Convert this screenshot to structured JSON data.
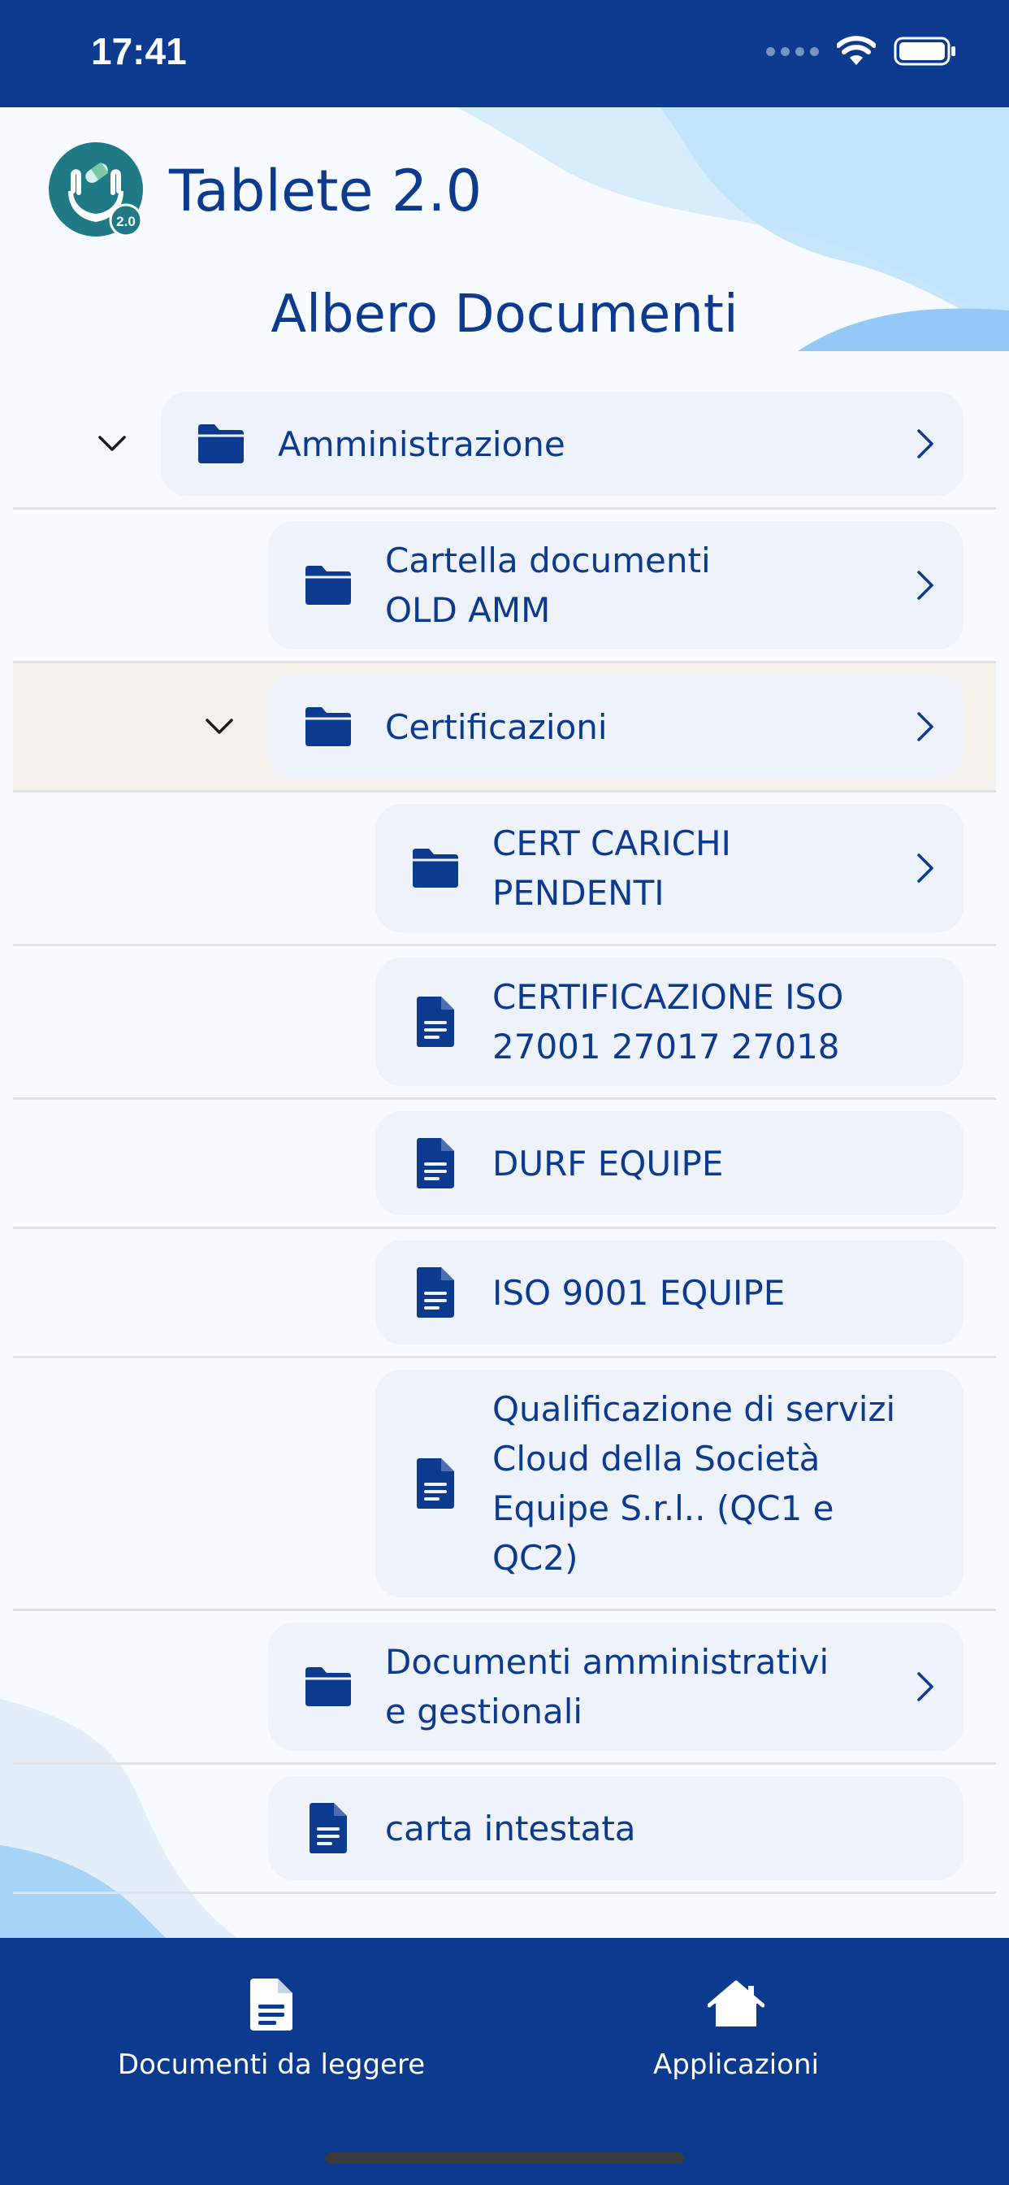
{
  "status": {
    "time": "17:41"
  },
  "app": {
    "title": "Tablete 2.0",
    "logo_badge": "2.0"
  },
  "page": {
    "title": "Albero Documenti"
  },
  "tree": [
    {
      "label": "Amministrazione",
      "kind": "folder",
      "depth": 0,
      "expanded": true,
      "chevron": true
    },
    {
      "label": "Cartella documenti\nOLD AMM",
      "kind": "folder",
      "depth": 1,
      "expanded": false,
      "chevron": true
    },
    {
      "label": "Certificazioni",
      "kind": "folder",
      "depth": 1,
      "expanded": true,
      "chevron": true,
      "selected": true
    },
    {
      "label": "CERT CARICHI\nPENDENTI",
      "kind": "folder",
      "depth": 2,
      "expanded": false,
      "chevron": true
    },
    {
      "label": "CERTIFICAZIONE ISO\n27001 27017 27018",
      "kind": "file",
      "depth": 2,
      "chevron": false
    },
    {
      "label": "DURF EQUIPE",
      "kind": "file",
      "depth": 2,
      "chevron": false
    },
    {
      "label": "ISO 9001 EQUIPE",
      "kind": "file",
      "depth": 2,
      "chevron": false
    },
    {
      "label": "Qualificazione di servizi\nCloud della Società\nEquipe S.r.l.. (QC1 e\nQC2)",
      "kind": "file",
      "depth": 2,
      "chevron": false
    },
    {
      "label": "Documenti amministrativi\ne gestionali",
      "kind": "folder",
      "depth": 1,
      "expanded": false,
      "chevron": true
    },
    {
      "label": "carta intestata",
      "kind": "file",
      "depth": 1,
      "chevron": false
    }
  ],
  "nav": {
    "left": {
      "label": "Documenti da leggere",
      "icon": "document-icon"
    },
    "right": {
      "label": "Applicazioni",
      "icon": "home-icon"
    }
  },
  "colors": {
    "primary": "#0b3a8f",
    "card": "#eef2fb",
    "selected": "#f5efe9",
    "accent_light": "#bfe2fb"
  }
}
